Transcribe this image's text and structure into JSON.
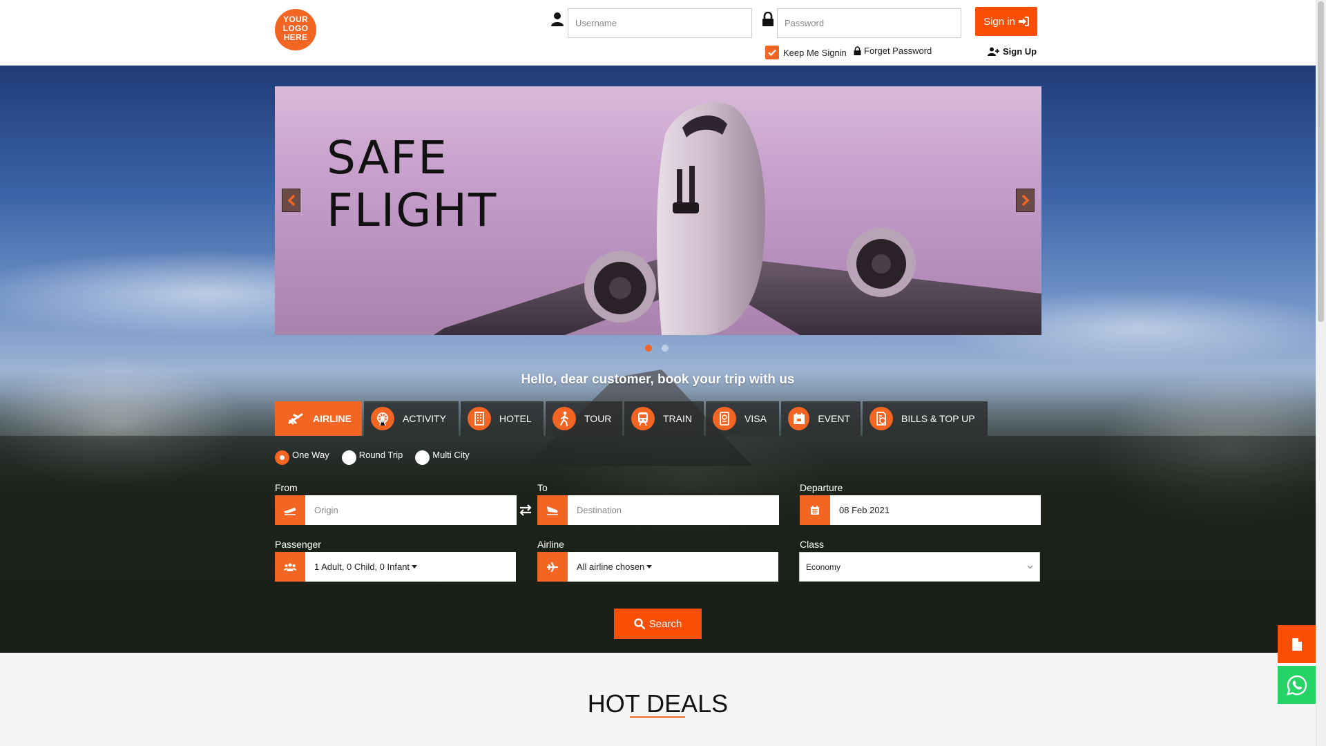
{
  "header": {
    "logo_lines": [
      "YOUR",
      "LOGO",
      "HERE"
    ],
    "username_placeholder": "Username",
    "password_placeholder": "Password",
    "signin_label": "Sign in",
    "keep_label": "Keep Me Signin",
    "forget_label": "Forget Password",
    "signup_label": "Sign Up"
  },
  "slider": {
    "title_lines": [
      "SAFE",
      "FLIGHT"
    ],
    "slide_count": 2,
    "active_slide": 1
  },
  "tagline": "Hello, dear customer, book your trip with us",
  "tabs": [
    {
      "label": "AIRLINE",
      "icon": "plane-icon",
      "active": true
    },
    {
      "label": "ACTIVITY",
      "icon": "ferris-wheel-icon",
      "active": false
    },
    {
      "label": "HOTEL",
      "icon": "building-icon",
      "active": false
    },
    {
      "label": "TOUR",
      "icon": "hiker-icon",
      "active": false
    },
    {
      "label": "TRAIN",
      "icon": "train-icon",
      "active": false
    },
    {
      "label": "VISA",
      "icon": "passport-icon",
      "active": false
    },
    {
      "label": "EVENT",
      "icon": "calendar-event-icon",
      "active": false
    },
    {
      "label": "BILLS & TOP UP",
      "icon": "bill-icon",
      "active": false
    }
  ],
  "trip_types": [
    {
      "label": "One Way",
      "checked": true
    },
    {
      "label": "Round Trip",
      "checked": false
    },
    {
      "label": "Multi City",
      "checked": false
    }
  ],
  "form": {
    "from_label": "From",
    "from_placeholder": "Origin",
    "to_label": "To",
    "to_placeholder": "Destination",
    "departure_label": "Departure",
    "departure_value": "08 Feb 2021",
    "passenger_label": "Passenger",
    "passenger_value": "1 Adult, 0 Child, 0 Infant",
    "airline_label": "Airline",
    "airline_value": "All airline chosen",
    "class_label": "Class",
    "class_value": "Economy",
    "search_label": "Search"
  },
  "deals": {
    "title": "HOT DEALS"
  },
  "colors": {
    "accent": "#f26522",
    "button": "#f84e05",
    "whatsapp": "#25d366"
  }
}
